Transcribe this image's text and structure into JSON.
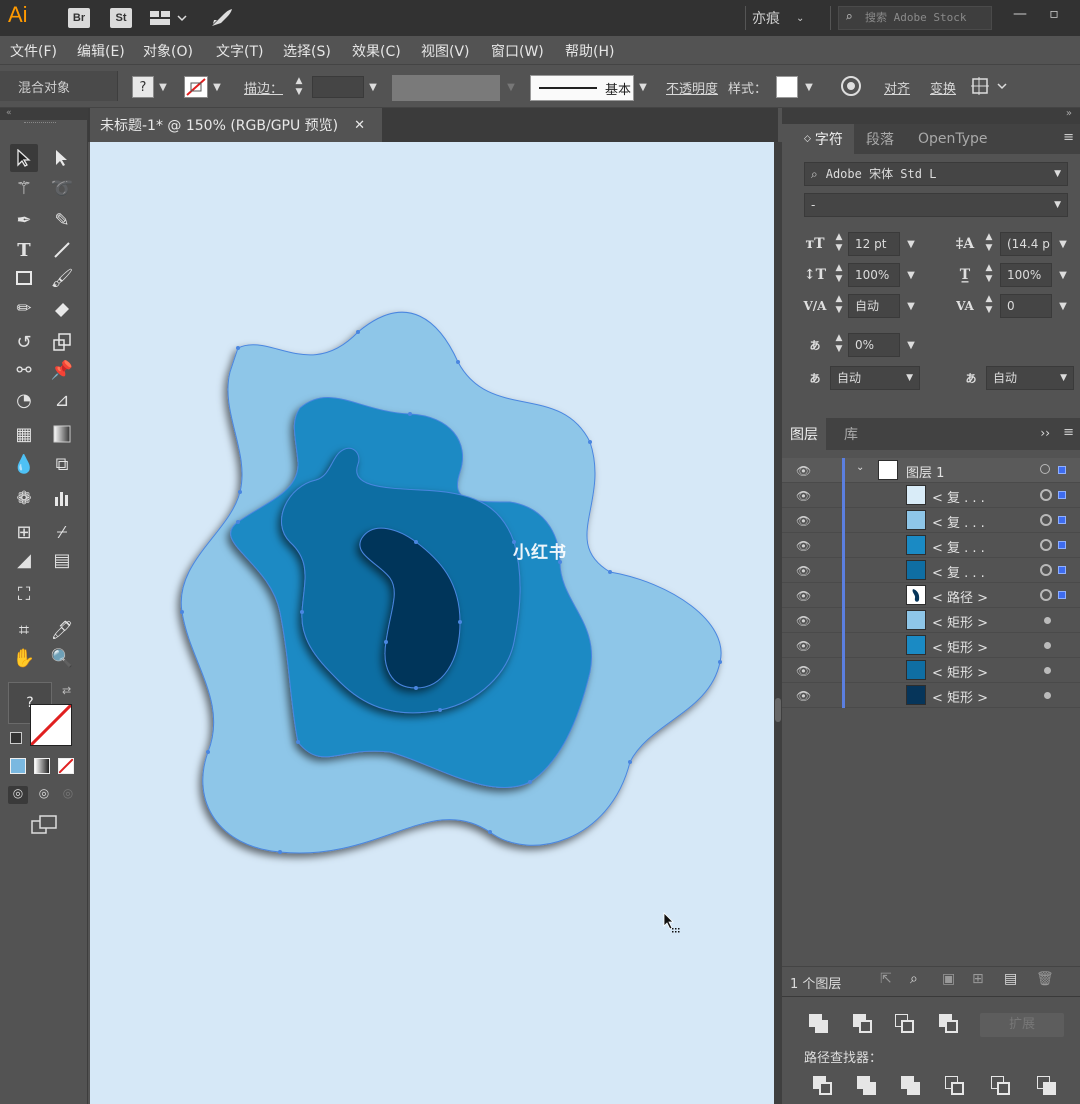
{
  "titlebar": {
    "app_logo": "Ai",
    "bridge_badge": "Br",
    "stock_badge": "St",
    "workspace": "亦痕",
    "search_placeholder": "搜索 Adobe Stock"
  },
  "menubar": {
    "items": [
      "文件(F)",
      "编辑(E)",
      "对象(O)",
      "文字(T)",
      "选择(S)",
      "效果(C)",
      "视图(V)",
      "窗口(W)",
      "帮助(H)"
    ]
  },
  "controlbar": {
    "selection_label": "混合对象",
    "fill_value": "?",
    "stroke_label": "描边：",
    "stroke_profile": "基本",
    "opacity_label": "不透明度",
    "style_label": "样式：",
    "align_label": "对齐",
    "transform_label": "变换"
  },
  "document": {
    "tab_title": "未标题-1* @ 150% (RGB/GPU 预览)",
    "watermark": "小红书",
    "colors": [
      "#8ec6e8",
      "#1a8ac4",
      "#0f6ea3",
      "#06355a"
    ]
  },
  "character_panel": {
    "tabs": [
      "字符",
      "段落",
      "OpenType"
    ],
    "font_family": "Adobe 宋体 Std L",
    "font_style": "-",
    "font_size": "12 pt",
    "leading": "(14.4 p",
    "vertical_scale": "100%",
    "horizontal_scale": "100%",
    "kerning": "自动",
    "tracking": "0",
    "tsume": "0%",
    "aki_left": "自动",
    "aki_right": "自动"
  },
  "layers_panel": {
    "tabs": [
      "图层",
      "库"
    ],
    "layer_name": "图层 1",
    "items": [
      {
        "name": "< 复 . . .",
        "color": "#d9ecf8"
      },
      {
        "name": "< 复 . . .",
        "color": "#8ec6e8"
      },
      {
        "name": "< 复 . . .",
        "color": "#1a8ac4"
      },
      {
        "name": "< 复 . . .",
        "color": "#0f6ea3"
      },
      {
        "name": "< 路径 >",
        "color": "#06355a"
      },
      {
        "name": "< 矩形 >",
        "color": "#8ec6e8"
      },
      {
        "name": "< 矩形 >",
        "color": "#1a8ac4"
      },
      {
        "name": "< 矩形 >",
        "color": "#0f6ea3"
      },
      {
        "name": "< 矩形 >",
        "color": "#06355a"
      }
    ],
    "footer_count": "1 个图层"
  },
  "pathfinder": {
    "label": "路径查找器：",
    "expand_label": "扩展"
  }
}
